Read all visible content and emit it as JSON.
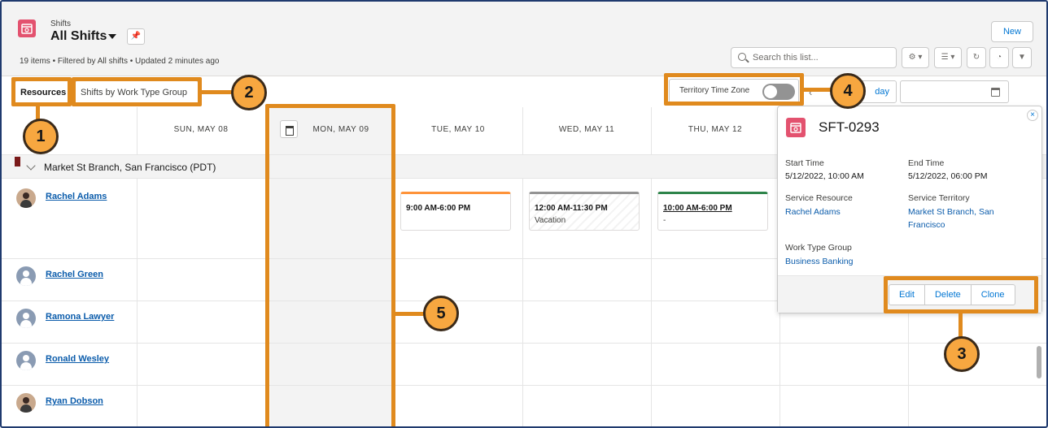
{
  "header": {
    "object_label": "Shifts",
    "list_title": "All Shifts",
    "meta": "19 items • Filtered by All shifts • Updated 2 minutes ago",
    "new_label": "New",
    "search_placeholder": "Search this list...",
    "pin_icon": "pin-icon",
    "settings_icon": "gear-icon",
    "display_icon": "table-view-icon",
    "refresh_icon": "refresh-icon",
    "chart_icon": "chart-icon",
    "filter_icon": "filter-icon"
  },
  "toolbar": {
    "tab_resources": "Resources",
    "tab_work_type": "Shifts by Work Type Group",
    "time_zone_label": "Territory Time Zone",
    "today_label": "day",
    "time_zone_toggle": "off"
  },
  "days": [
    {
      "label": "SUN, MAY 08"
    },
    {
      "label": "MON, MAY 09"
    },
    {
      "label": "TUE, MAY 10"
    },
    {
      "label": "WED, MAY 11"
    },
    {
      "label": "THU, MAY 12"
    }
  ],
  "group": {
    "label": "Market St Branch, San Francisco (PDT)"
  },
  "resources": [
    {
      "name": "Rachel Adams",
      "avatar": "photo"
    },
    {
      "name": "Rachel Green",
      "avatar": "generic"
    },
    {
      "name": "Ramona Lawyer",
      "avatar": "generic"
    },
    {
      "name": "Ronald Wesley",
      "avatar": "generic"
    },
    {
      "name": "Ryan Dobson",
      "avatar": "photo"
    }
  ],
  "shifts": [
    {
      "time": "9:00 AM-6:00 PM",
      "sub": "",
      "color": "#fe9339"
    },
    {
      "time": "12:00 AM-11:30 PM",
      "sub": "Vacation",
      "color": "#939393"
    },
    {
      "time": "10:00 AM-6:00 PM",
      "sub": "-",
      "color": "#2e844a"
    }
  ],
  "popover": {
    "title": "SFT-0293",
    "start_label": "Start Time",
    "start_value": "5/12/2022, 10:00 AM",
    "end_label": "End Time",
    "end_value": "5/12/2022, 06:00 PM",
    "resource_label": "Service Resource",
    "resource_value": "Rachel Adams",
    "territory_label": "Service Territory",
    "territory_value": "Market St Branch, San Francisco",
    "wtg_label": "Work Type Group",
    "wtg_value": "Business Banking",
    "edit": "Edit",
    "delete": "Delete",
    "clone": "Clone",
    "close": "×"
  },
  "callouts": [
    "1",
    "2",
    "3",
    "4",
    "5"
  ],
  "colors": {
    "accent": "#0176d3",
    "callout": "#e08a1e",
    "shift_icon": "#e3526f"
  }
}
